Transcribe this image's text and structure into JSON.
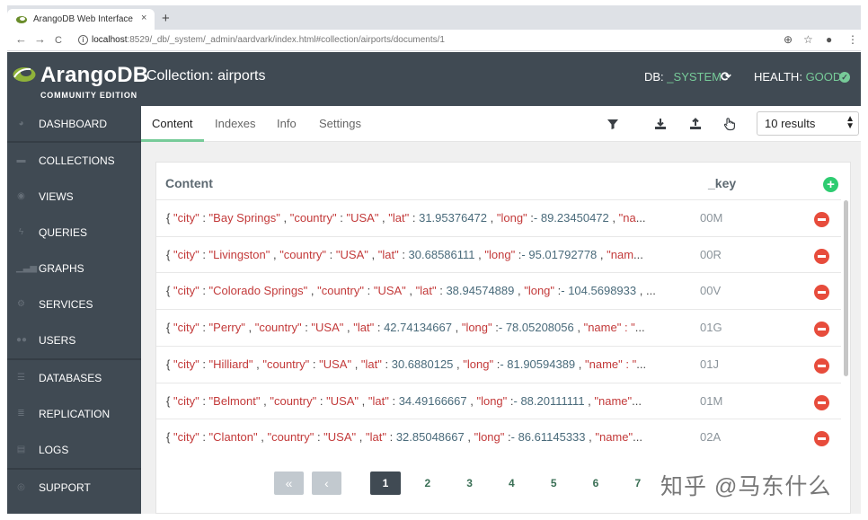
{
  "browser": {
    "tab_title": "ArangoDB Web Interface",
    "tab_close": "×",
    "new_tab": "+",
    "back_icon": "←",
    "forward_icon": "→",
    "reload_icon": "C",
    "url_host": "localhost",
    "url_rest": ":8529/_db/_system/_admin/aardvark/index.html#collection/airports/documents/1",
    "zoom_icon": "⊕",
    "star_icon": "☆",
    "account_icon": "●",
    "menu_icon": "⋮"
  },
  "header": {
    "logo_text": "ArangoDB",
    "logo_sub": "COMMUNITY EDITION",
    "title": "Collection: airports",
    "db_label": "DB:",
    "db_value": "_SYSTEM",
    "health_label": "HEALTH:",
    "health_value": "GOOD",
    "check": "✓"
  },
  "sidebar": {
    "items": [
      {
        "label": "DASHBOARD",
        "icon": "dashboard-icon"
      },
      {
        "label": "COLLECTIONS",
        "icon": "folder-icon"
      },
      {
        "label": "VIEWS",
        "icon": "eye-icon"
      },
      {
        "label": "QUERIES",
        "icon": "bolt-icon"
      },
      {
        "label": "GRAPHS",
        "icon": "graph-icon"
      },
      {
        "label": "SERVICES",
        "icon": "cogs-icon"
      },
      {
        "label": "USERS",
        "icon": "users-icon"
      },
      {
        "label": "DATABASES",
        "icon": "database-icon"
      },
      {
        "label": "REPLICATION",
        "icon": "server-icon"
      },
      {
        "label": "LOGS",
        "icon": "file-icon"
      },
      {
        "label": "SUPPORT",
        "icon": "lifebuoy-icon"
      }
    ]
  },
  "subnav": {
    "tabs": [
      {
        "label": "Content"
      },
      {
        "label": "Indexes"
      },
      {
        "label": "Info"
      },
      {
        "label": "Settings"
      }
    ],
    "results": "10 results",
    "select_arrows": "▲▼"
  },
  "table": {
    "col_content": "Content",
    "col_key": "_key",
    "add": "+",
    "rows": [
      {
        "city": "Bay Springs",
        "country": "USA",
        "lat": "31.95376472",
        "long": "- 89.23450472",
        "tail": "\"na",
        "key": "00M"
      },
      {
        "city": "Livingston",
        "country": "USA",
        "lat": "30.68586111",
        "long": "- 95.01792778",
        "tail": "\"nam",
        "key": "00R"
      },
      {
        "city": "Colorado Springs",
        "country": "USA",
        "lat": "38.94574889",
        "long": "- 104.5698933",
        "tail": "",
        "key": "00V"
      },
      {
        "city": "Perry",
        "country": "USA",
        "lat": "42.74134667",
        "long": "- 78.05208056",
        "tail": "\"name\" : \"",
        "key": "01G"
      },
      {
        "city": "Hilliard",
        "country": "USA",
        "lat": "30.6880125",
        "long": "- 81.90594389",
        "tail": "\"name\" : \"",
        "key": "01J"
      },
      {
        "city": "Belmont",
        "country": "USA",
        "lat": "34.49166667",
        "long": "- 88.20111111",
        "tail": "\"name\"",
        "key": "01M"
      },
      {
        "city": "Clanton",
        "country": "USA",
        "lat": "32.85048667",
        "long": "- 86.61145333",
        "tail": "\"name\"",
        "key": "02A"
      }
    ]
  },
  "pager": {
    "first": "«",
    "prev": "‹",
    "pages": [
      "1",
      "2",
      "3",
      "4",
      "5",
      "6",
      "7"
    ],
    "active": "1"
  },
  "watermark": "知乎 @马东什么"
}
